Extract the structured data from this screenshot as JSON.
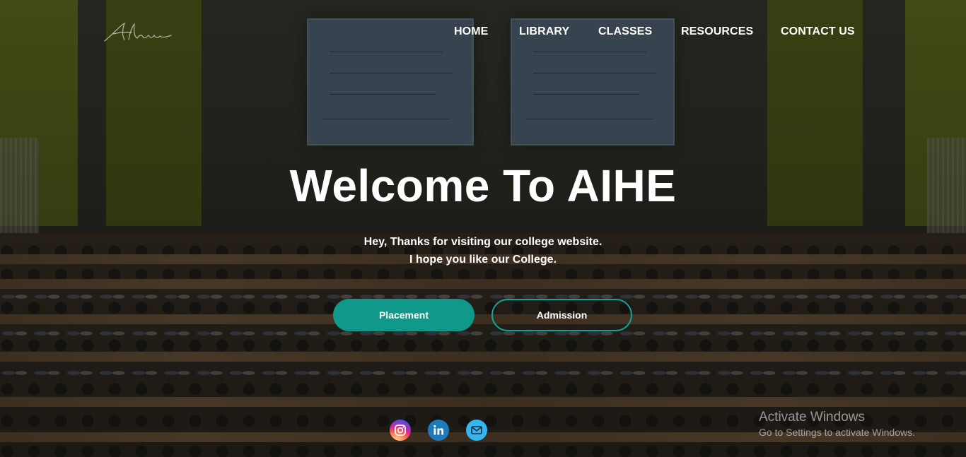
{
  "logo": {
    "text": "Abhinav"
  },
  "nav": {
    "items": [
      {
        "label": "HOME"
      },
      {
        "label": "LIBRARY"
      },
      {
        "label": "CLASSES"
      },
      {
        "label": "RESOURCES"
      },
      {
        "label": "CONTACT US"
      }
    ]
  },
  "hero": {
    "title": "Welcome To AIHE",
    "line1": "Hey, Thanks for visiting our college website.",
    "line2": "I hope you like our College."
  },
  "buttons": {
    "placement": "Placement",
    "admission": "Admission"
  },
  "social": [
    "instagram-icon",
    "linkedin-icon",
    "mail-icon"
  ],
  "colors": {
    "accent": "#10998a",
    "accent_border": "#12a394",
    "linkedin": "#1c7bb8",
    "mail": "#36b6f0"
  },
  "watermark": {
    "title": "Activate Windows",
    "subtitle": "Go to Settings to activate Windows."
  }
}
